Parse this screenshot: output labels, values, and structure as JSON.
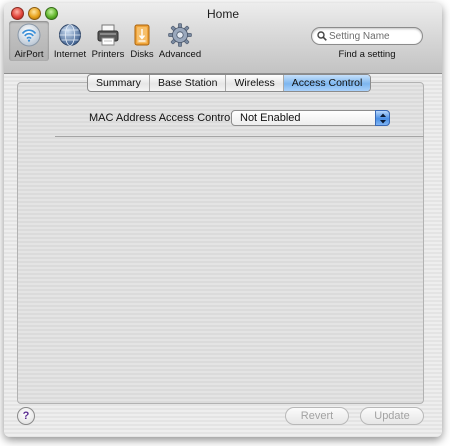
{
  "window": {
    "title": "Home"
  },
  "toolbar": {
    "items": [
      {
        "label": "AirPort",
        "icon": "airport-icon",
        "selected": true
      },
      {
        "label": "Internet",
        "icon": "globe-icon",
        "selected": false
      },
      {
        "label": "Printers",
        "icon": "printer-icon",
        "selected": false
      },
      {
        "label": "Disks",
        "icon": "disk-icon",
        "selected": false
      },
      {
        "label": "Advanced",
        "icon": "gear-icon",
        "selected": false
      }
    ]
  },
  "search": {
    "placeholder": "Setting Name",
    "caption": "Find a setting"
  },
  "tabs": [
    {
      "label": "Summary",
      "active": false
    },
    {
      "label": "Base Station",
      "active": false
    },
    {
      "label": "Wireless",
      "active": false
    },
    {
      "label": "Access Control",
      "active": true
    }
  ],
  "access_control": {
    "label": "MAC Address Access Control:",
    "value": "Not Enabled"
  },
  "buttons": {
    "help": "?",
    "revert": "Revert",
    "update": "Update"
  },
  "colors": {
    "accent": "#7db6ef",
    "window_bg": "#ececec"
  }
}
